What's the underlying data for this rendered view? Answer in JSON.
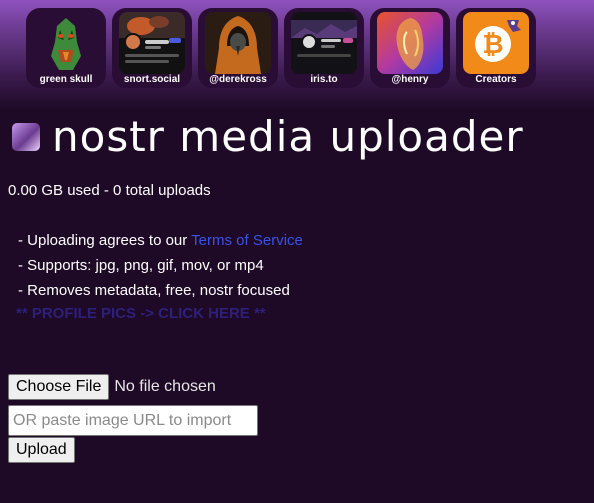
{
  "tiles": [
    {
      "label": "green skull",
      "icon": "green-skull-avatar"
    },
    {
      "label": "snort.social",
      "icon": "snort-social-screenshot"
    },
    {
      "label": "@derekross",
      "icon": "hooded-figure-avatar"
    },
    {
      "label": "iris.to",
      "icon": "iris-to-screenshot"
    },
    {
      "label": "@henry",
      "icon": "henry-avatar"
    },
    {
      "label": "Creators",
      "icon": "bitcoin-creators-icon"
    }
  ],
  "header": {
    "title": "nostr media uploader",
    "logo_icon": "nostr-build-logo"
  },
  "usage": "0.00 GB used - 0 total uploads",
  "info": {
    "line1_prefix": "- Uploading agrees to our ",
    "line1_link": "Terms of Service",
    "line2": "- Supports: jpg, png, gif, mov, or mp4",
    "line3": "- Removes metadata, free, nostr focused"
  },
  "profile_link": "** PROFILE PICS -> CLICK HERE **",
  "upload_form": {
    "choose_file_label": "Choose File",
    "no_file_text": "No file chosen",
    "url_placeholder": "OR paste image URL to import",
    "upload_label": "Upload"
  },
  "colors": {
    "background": "#1e0a26",
    "link": "#3a52e8",
    "profile_link": "#2e1f7a",
    "tile_bg": "#2a0d35"
  }
}
